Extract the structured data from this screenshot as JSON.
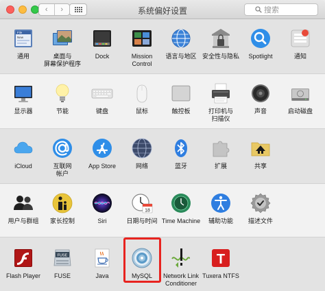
{
  "window": {
    "title": "系统偏好设置"
  },
  "toolbar": {
    "back_glyph": "‹",
    "forward_glyph": "›",
    "search_placeholder": "搜索"
  },
  "rows": [
    {
      "items": [
        {
          "label": "通用",
          "icon": "general-icon"
        },
        {
          "label": "桌面与\n屏幕保护程序",
          "icon": "desktop-icon"
        },
        {
          "label": "Dock",
          "icon": "dock-icon"
        },
        {
          "label": "Mission\nControl",
          "icon": "mission-control-icon"
        },
        {
          "label": "语言与地区",
          "icon": "language-icon"
        },
        {
          "label": "安全性与隐私",
          "icon": "security-icon"
        },
        {
          "label": "Spotlight",
          "icon": "spotlight-icon"
        },
        {
          "label": "通知",
          "icon": "notifications-icon"
        }
      ]
    },
    {
      "items": [
        {
          "label": "显示器",
          "icon": "display-icon"
        },
        {
          "label": "节能",
          "icon": "energy-icon"
        },
        {
          "label": "键盘",
          "icon": "keyboard-icon"
        },
        {
          "label": "鼠标",
          "icon": "mouse-icon"
        },
        {
          "label": "触控板",
          "icon": "trackpad-icon"
        },
        {
          "label": "打印机与\n扫描仪",
          "icon": "printer-icon"
        },
        {
          "label": "声音",
          "icon": "sound-icon"
        },
        {
          "label": "启动磁盘",
          "icon": "startup-disk-icon"
        }
      ]
    },
    {
      "items": [
        {
          "label": "iCloud",
          "icon": "icloud-icon"
        },
        {
          "label": "互联网\n帐户",
          "icon": "internet-accounts-icon"
        },
        {
          "label": "App Store",
          "icon": "app-store-icon"
        },
        {
          "label": "网络",
          "icon": "network-icon"
        },
        {
          "label": "蓝牙",
          "icon": "bluetooth-icon"
        },
        {
          "label": "扩展",
          "icon": "extensions-icon"
        },
        {
          "label": "共享",
          "icon": "sharing-icon"
        }
      ]
    },
    {
      "items": [
        {
          "label": "用户与群组",
          "icon": "users-icon"
        },
        {
          "label": "家长控制",
          "icon": "parental-icon"
        },
        {
          "label": "Siri",
          "icon": "siri-icon"
        },
        {
          "label": "日期与时间",
          "icon": "date-time-icon"
        },
        {
          "label": "Time Machine",
          "icon": "time-machine-icon"
        },
        {
          "label": "辅助功能",
          "icon": "accessibility-icon"
        },
        {
          "label": "描述文件",
          "icon": "profiles-icon"
        }
      ]
    },
    {
      "items": [
        {
          "label": "Flash Player",
          "icon": "flash-icon"
        },
        {
          "label": "FUSE",
          "icon": "fuse-icon"
        },
        {
          "label": "Java",
          "icon": "java-icon"
        },
        {
          "label": "MySQL",
          "icon": "mysql-icon"
        },
        {
          "label": "Network Link\nConditioner",
          "icon": "network-link-icon"
        },
        {
          "label": "Tuxera NTFS",
          "icon": "tuxera-icon"
        }
      ]
    }
  ],
  "icon_glyphs": {
    "general_file_text": "File",
    "general_new_text": "New",
    "calendar_day": "18",
    "tuxera_letter": "T",
    "fuse_text": "FUSE"
  },
  "colors": {
    "highlight": "#e8231f"
  }
}
